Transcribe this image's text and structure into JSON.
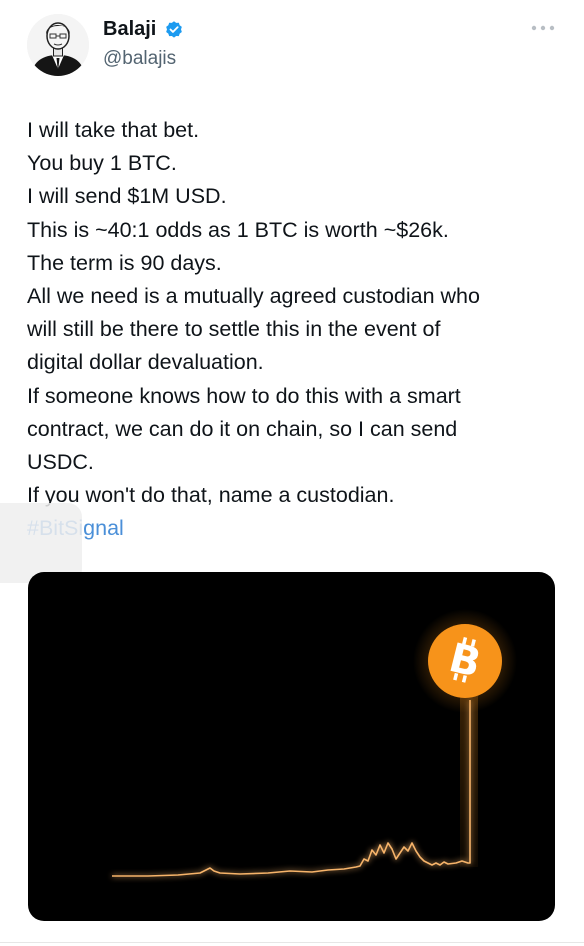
{
  "author": {
    "display_name": "Balaji",
    "handle": "@balajis",
    "verified": true
  },
  "tweet": {
    "lines": [
      "I will take that bet.",
      "You buy 1 BTC.",
      "I will send $1M USD.",
      "This is ~40:1 odds as 1 BTC is worth ~$26k.",
      "The term is 90 days.",
      "All we need is a mutually agreed custodian who",
      "will still be there to settle this in the event of",
      "digital dollar devaluation.",
      "If someone knows how to do this with a smart",
      "contract, we can do it on chain, so I can send",
      "USDC.",
      "If you won't do that, name a custodian."
    ],
    "hashtag": "#BitSignal"
  },
  "media": {
    "type": "bitcoin-price-spike-graphic",
    "background_color": "#000000",
    "line_color": "#f7931a",
    "coin_icon": "bitcoin-icon",
    "coin_color": "#f7931a"
  },
  "colors": {
    "text": "#0f1419",
    "secondary_text": "#536471",
    "link": "#4a8fd8",
    "verified_badge": "#1d9bf0"
  },
  "icons": {
    "verified": "verified-badge-icon",
    "more": "more-options-icon"
  }
}
